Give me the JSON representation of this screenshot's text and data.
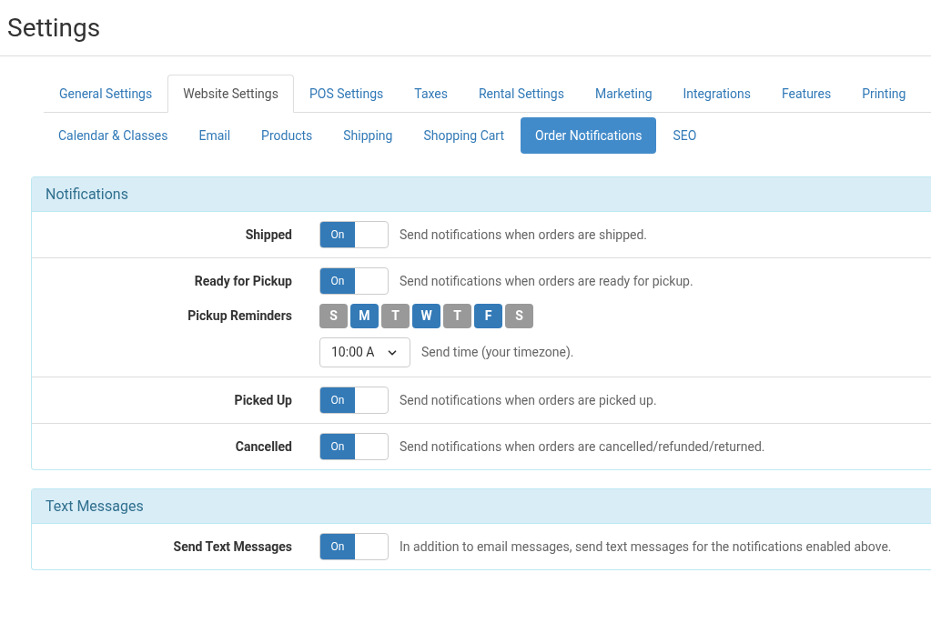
{
  "title": "Settings",
  "tabs": [
    {
      "label": "General Settings",
      "selected": false
    },
    {
      "label": "Website Settings",
      "selected": true
    },
    {
      "label": "POS Settings",
      "selected": false
    },
    {
      "label": "Taxes",
      "selected": false
    },
    {
      "label": "Rental Settings",
      "selected": false
    },
    {
      "label": "Marketing",
      "selected": false
    },
    {
      "label": "Integrations",
      "selected": false
    },
    {
      "label": "Features",
      "selected": false
    },
    {
      "label": "Printing",
      "selected": false
    }
  ],
  "subtabs": [
    {
      "label": "Calendar & Classes",
      "selected": false
    },
    {
      "label": "Email",
      "selected": false
    },
    {
      "label": "Products",
      "selected": false
    },
    {
      "label": "Shipping",
      "selected": false
    },
    {
      "label": "Shopping Cart",
      "selected": false
    },
    {
      "label": "Order Notifications",
      "selected": true
    },
    {
      "label": "SEO",
      "selected": false
    }
  ],
  "panels": [
    {
      "title": "Notifications",
      "groups": [
        [
          {
            "kind": "toggle",
            "label": "Shipped",
            "toggle": "On",
            "on": true,
            "help": "Send notifications when orders are shipped."
          }
        ],
        [
          {
            "kind": "toggle",
            "label": "Ready for Pickup",
            "toggle": "On",
            "on": true,
            "help": "Send notifications when orders are ready for pickup."
          },
          {
            "kind": "days",
            "label": "Pickup Reminders",
            "days": [
              {
                "label": "S",
                "selected": false
              },
              {
                "label": "M",
                "selected": true
              },
              {
                "label": "T",
                "selected": false
              },
              {
                "label": "W",
                "selected": true
              },
              {
                "label": "T",
                "selected": false
              },
              {
                "label": "F",
                "selected": true
              },
              {
                "label": "S",
                "selected": false
              }
            ]
          },
          {
            "kind": "time",
            "value": "10:00 A",
            "help": "Send time (your timezone)."
          }
        ],
        [
          {
            "kind": "toggle",
            "label": "Picked Up",
            "toggle": "On",
            "on": true,
            "help": "Send notifications when orders are picked up."
          }
        ],
        [
          {
            "kind": "toggle",
            "label": "Cancelled",
            "toggle": "On",
            "on": true,
            "help": "Send notifications when orders are cancelled/refunded/returned."
          }
        ]
      ]
    },
    {
      "title": "Text Messages",
      "groups": [
        [
          {
            "kind": "toggle",
            "label": "Send Text Messages",
            "toggle": "On",
            "on": true,
            "help": "In addition to email messages, send text messages for the notifications enabled above."
          }
        ]
      ]
    }
  ]
}
